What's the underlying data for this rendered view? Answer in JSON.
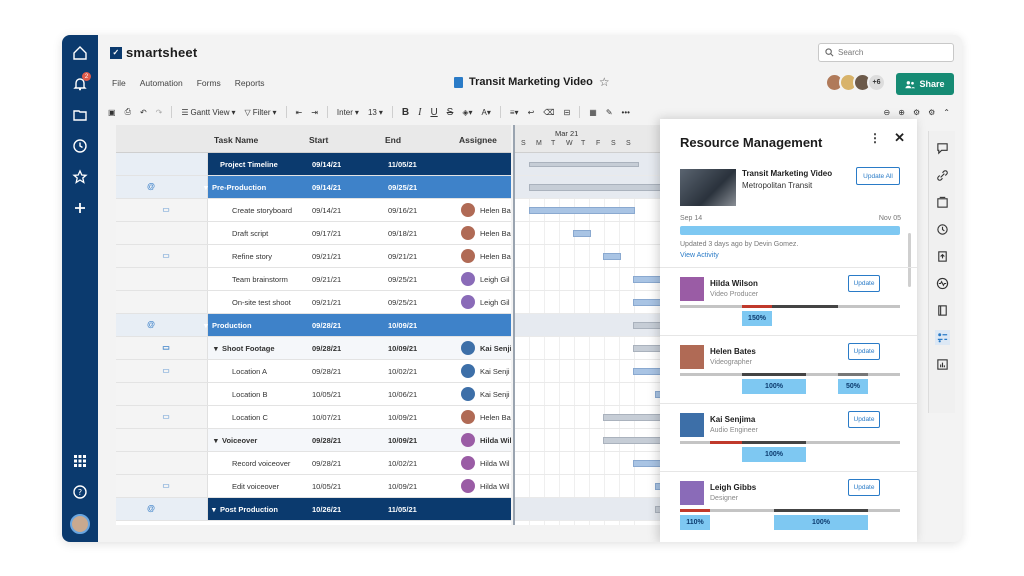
{
  "app": {
    "brand": "smartsheet",
    "doc_title": "Transit Marketing Video",
    "menu": [
      "File",
      "Automation",
      "Forms",
      "Reports"
    ],
    "search_placeholder": "Search",
    "share_label": "Share",
    "collab_more": "+6",
    "notification_count": "2"
  },
  "toolbar": {
    "view_label": "Gantt View",
    "filter_label": "Filter",
    "font_label": "Inter",
    "font_size": "13",
    "bold": "B",
    "italic": "I",
    "underline": "U",
    "strike": "S"
  },
  "grid": {
    "headers": {
      "task": "Task Name",
      "start": "Start",
      "end": "End",
      "assignee": "Assignee"
    },
    "rows": [
      {
        "kind": "top",
        "task": "Project Timeline",
        "start": "09/14/21",
        "end": "11/05/21",
        "assignee": ""
      },
      {
        "kind": "phase",
        "task": "Pre-Production",
        "start": "09/14/21",
        "end": "09/25/21",
        "assignee": ""
      },
      {
        "kind": "task",
        "task": "Create storyboard",
        "start": "09/14/21",
        "end": "09/16/21",
        "assignee": "Helen Ba"
      },
      {
        "kind": "task",
        "task": "Draft script",
        "start": "09/17/21",
        "end": "09/18/21",
        "assignee": "Helen Ba"
      },
      {
        "kind": "task",
        "task": "Refine story",
        "start": "09/21/21",
        "end": "09/21/21",
        "assignee": "Helen Ba"
      },
      {
        "kind": "task",
        "task": "Team brainstorm",
        "start": "09/21/21",
        "end": "09/25/21",
        "assignee": "Leigh Gil"
      },
      {
        "kind": "task",
        "task": "On-site test shoot",
        "start": "09/21/21",
        "end": "09/25/21",
        "assignee": "Leigh Gil"
      },
      {
        "kind": "phase",
        "task": "Production",
        "start": "09/28/21",
        "end": "10/09/21",
        "assignee": ""
      },
      {
        "kind": "sub",
        "task": "Shoot Footage",
        "start": "09/28/21",
        "end": "10/09/21",
        "assignee": "Kai Senji"
      },
      {
        "kind": "task",
        "task": "Location A",
        "start": "09/28/21",
        "end": "10/02/21",
        "assignee": "Kai Senji"
      },
      {
        "kind": "task",
        "task": "Location B",
        "start": "10/05/21",
        "end": "10/06/21",
        "assignee": "Kai Senji"
      },
      {
        "kind": "task",
        "task": "Location C",
        "start": "10/07/21",
        "end": "10/09/21",
        "assignee": "Helen Ba"
      },
      {
        "kind": "sub",
        "task": "Voiceover",
        "start": "09/28/21",
        "end": "10/09/21",
        "assignee": "Hilda Wil"
      },
      {
        "kind": "task",
        "task": "Record voiceover",
        "start": "09/28/21",
        "end": "10/02/21",
        "assignee": "Hilda Wil"
      },
      {
        "kind": "task",
        "task": "Edit voiceover",
        "start": "10/05/21",
        "end": "10/09/21",
        "assignee": "Hilda Wil"
      },
      {
        "kind": "top",
        "task": "Post Production",
        "start": "10/26/21",
        "end": "11/05/21",
        "assignee": ""
      }
    ]
  },
  "gantt": {
    "month": "Mar 21",
    "days": [
      "S",
      "M",
      "T",
      "W",
      "T",
      "F",
      "S",
      "S"
    ]
  },
  "panel": {
    "title": "Resource Management",
    "project_name": "Transit Marketing Video",
    "project_org": "Metropolitan Transit",
    "update_all": "Update All",
    "date_start": "Sep 14",
    "date_end": "Nov 05",
    "updated_text": "Updated 3 days ago by Devin Gomez.",
    "view_activity": "View Activity",
    "update_label": "Update",
    "people": [
      {
        "name": "Hilda Wilson",
        "role": "Video Producer",
        "pills": [
          "150%"
        ]
      },
      {
        "name": "Helen Bates",
        "role": "Videographer",
        "pills": [
          "100%",
          "50%"
        ]
      },
      {
        "name": "Kai Senjima",
        "role": "Audio Engineer",
        "pills": [
          "100%"
        ]
      },
      {
        "name": "Leigh Gibbs",
        "role": "Designer",
        "pills": [
          "110%",
          "100%"
        ]
      }
    ]
  },
  "colors": {
    "nav": "#0b3a6e",
    "phase": "#3e82c9",
    "share": "#168b74",
    "pill": "#7ec8f2",
    "overload": "#c0392b"
  }
}
